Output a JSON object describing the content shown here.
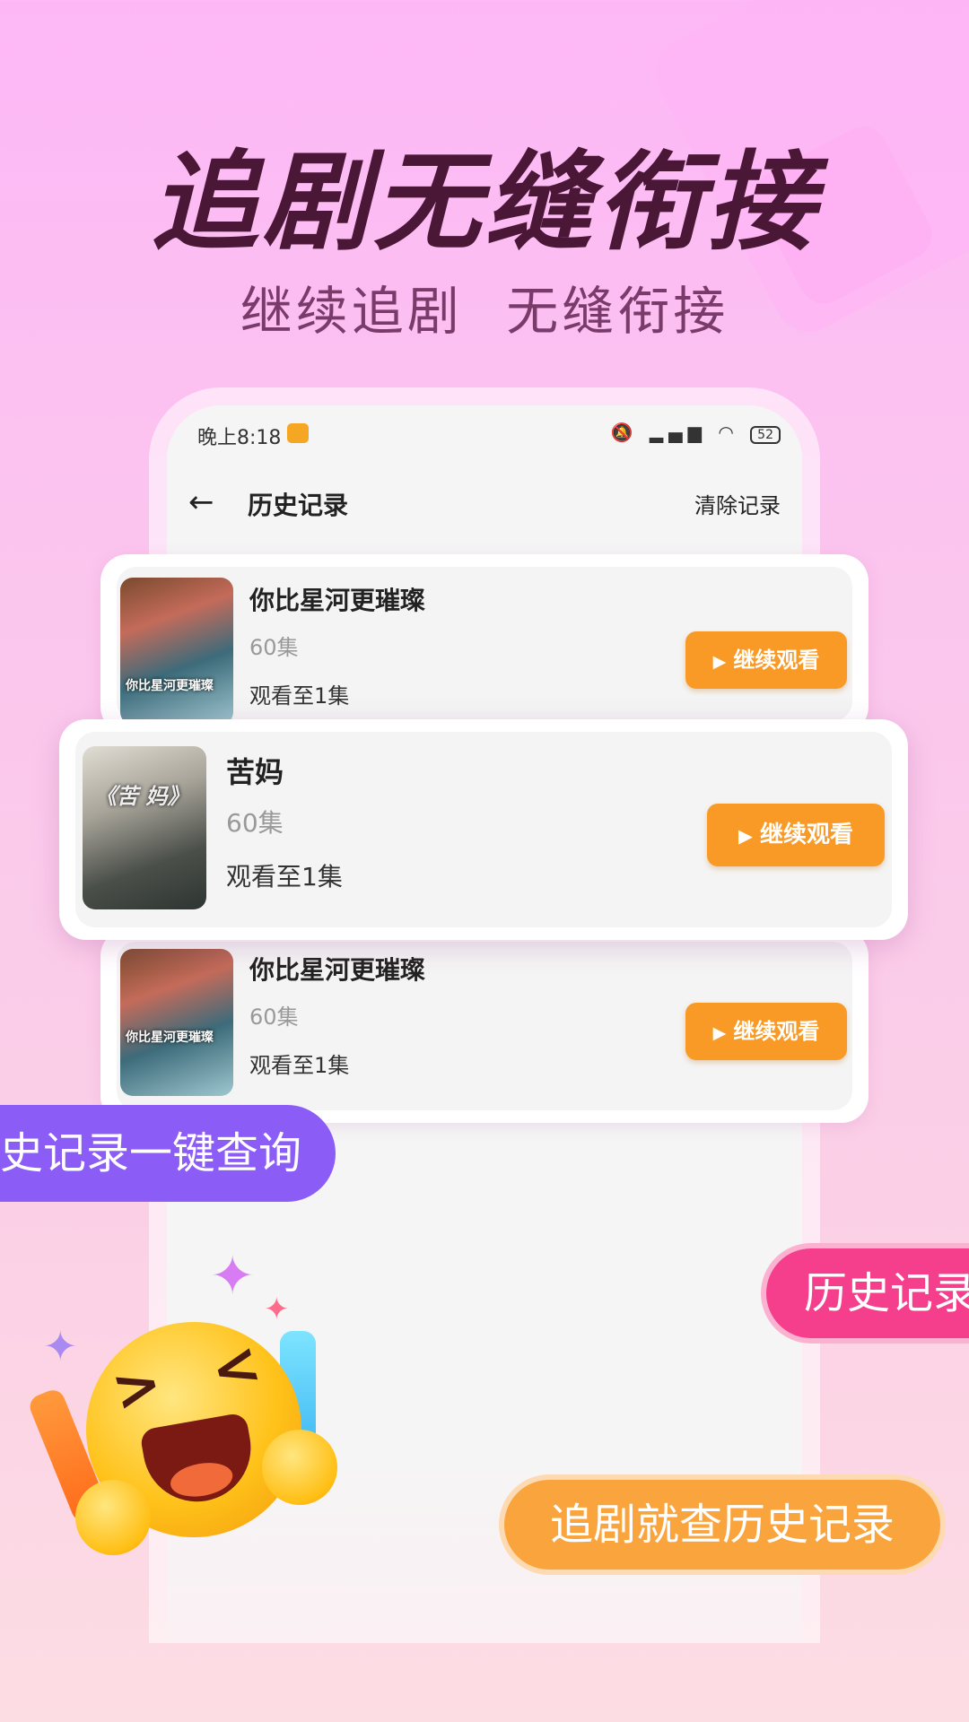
{
  "headline": "追剧无缝衔接",
  "subhead": "继续追剧  无缝衔接",
  "status_bar": {
    "time": "晚上8:18",
    "battery": "52"
  },
  "nav": {
    "title": "历史记录",
    "clear_label": "清除记录"
  },
  "history": [
    {
      "title": "你比星河更璀璨",
      "episodes": "60集",
      "progress": "观看至1集",
      "button": "继续观看",
      "poster_text": "你比星河更璀璨"
    },
    {
      "title": "苦妈",
      "episodes": "60集",
      "progress": "观看至1集",
      "button": "继续观看",
      "poster_text": "《苦 妈》"
    },
    {
      "title": "你比星河更璀璨",
      "episodes": "60集",
      "progress": "观看至1集",
      "button": "继续观看",
      "poster_text": "你比星河更璀璨"
    }
  ],
  "pills": {
    "purple": "史记录一键查询",
    "pink": "历史记录",
    "orange": "追剧就查历史记录"
  },
  "colors": {
    "button_orange": "#f89a25",
    "pill_purple": "#8b5cf6",
    "pill_pink": "#f53f8c",
    "pill_orange": "#faa43d",
    "headline": "#4b1737"
  }
}
